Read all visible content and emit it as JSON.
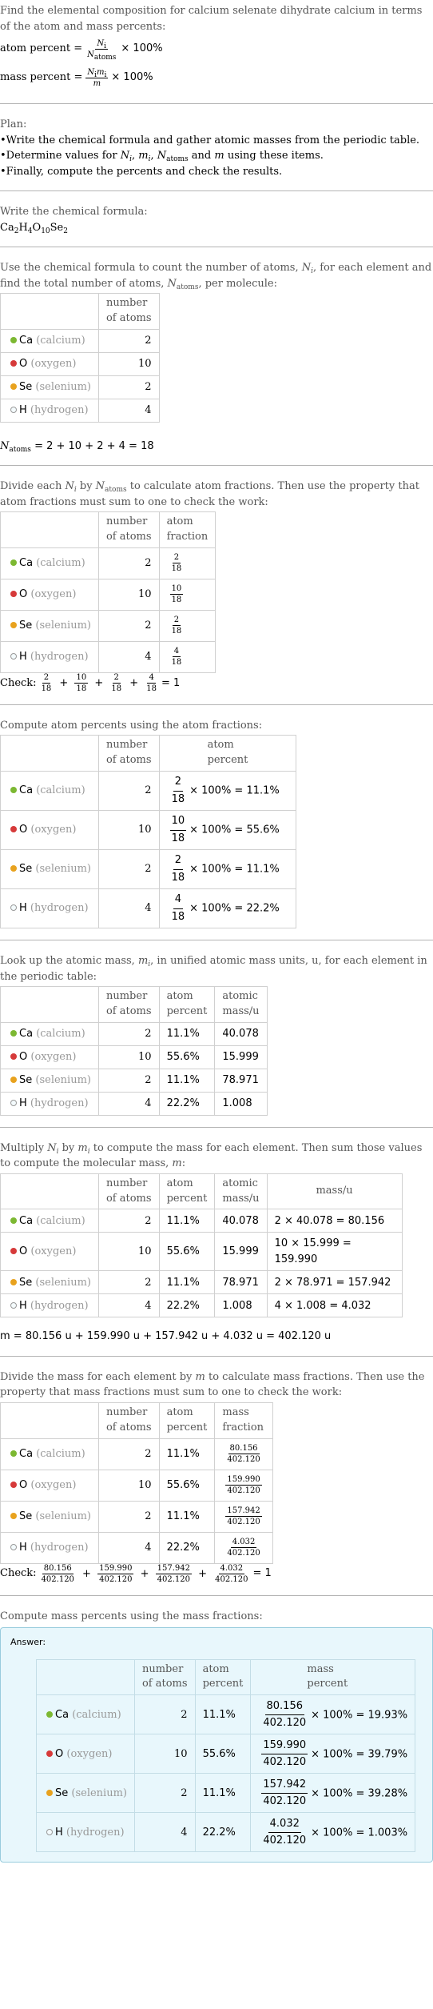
{
  "intro": {
    "question": "Find the elemental composition for calcium selenate dihydrate calcium in terms of the atom and mass percents:",
    "atom_percent_label": "atom percent =",
    "mass_percent_label": "mass percent =",
    "times_100": "× 100%",
    "atom_frac_num": "N",
    "atom_frac_num_sub": "i",
    "atom_frac_den": "N",
    "atom_frac_den_sub": "atoms",
    "mass_frac_num": "N",
    "mass_frac_num_sub": "i",
    "mass_frac_num2": "m",
    "mass_frac_num2_sub": "i",
    "mass_frac_den": "m"
  },
  "plan": {
    "title": "Plan:",
    "items": [
      "Write the chemical formula and gather atomic masses from the periodic table.",
      "Determine values for N_i, m_i, N_atoms and m using these items.",
      "Finally, compute the percents and check the results."
    ],
    "item2_prefix": "Determine values for ",
    "item2_suffix": " using these items."
  },
  "formula": {
    "title": "Write the chemical formula:",
    "parts": [
      {
        "sym": "Ca",
        "sub": "2"
      },
      {
        "sym": "H",
        "sub": "4"
      },
      {
        "sym": "O",
        "sub": "10"
      },
      {
        "sym": "Se",
        "sub": "2"
      }
    ]
  },
  "elements": [
    {
      "symbol": "Ca",
      "name": "(calcium)",
      "color": "#7cb832",
      "hollow": false,
      "atoms": "2",
      "atom_fraction_num": "2",
      "atom_fraction_den": "18",
      "atom_percent": "11.1%",
      "atomic_mass": "40.078",
      "mass_calc": "2 × 40.078 = 80.156",
      "mass": "80.156",
      "mass_percent": "19.93%"
    },
    {
      "symbol": "O",
      "name": "(oxygen)",
      "color": "#d63a3a",
      "hollow": false,
      "atoms": "10",
      "atom_fraction_num": "10",
      "atom_fraction_den": "18",
      "atom_percent": "55.6%",
      "atomic_mass": "15.999",
      "mass_calc": "10 × 15.999 = 159.990",
      "mass": "159.990",
      "mass_percent": "39.79%"
    },
    {
      "symbol": "Se",
      "name": "(selenium)",
      "color": "#e8a21e",
      "hollow": false,
      "atoms": "2",
      "atom_fraction_num": "2",
      "atom_fraction_den": "18",
      "atom_percent": "11.1%",
      "atomic_mass": "78.971",
      "mass_calc": "2 × 78.971 = 157.942",
      "mass": "157.942",
      "mass_percent": "39.28%"
    },
    {
      "symbol": "H",
      "name": "(hydrogen)",
      "color": "#f4fbfd",
      "hollow": true,
      "atoms": "4",
      "atom_fraction_num": "4",
      "atom_fraction_den": "18",
      "atom_percent": "22.2%",
      "atomic_mass": "1.008",
      "mass_calc": "4 × 1.008 = 4.032",
      "mass": "4.032",
      "mass_percent": "1.003%"
    }
  ],
  "headers": {
    "number_of_atoms": [
      "number",
      "of atoms"
    ],
    "atom_fraction": [
      "atom",
      "fraction"
    ],
    "atom_percent": [
      "atom",
      "percent"
    ],
    "atomic_mass": [
      "atomic",
      "mass/u"
    ],
    "mass": "mass/u",
    "mass_fraction": [
      "mass",
      "fraction"
    ],
    "mass_percent": [
      "mass",
      "percent"
    ]
  },
  "step_count": {
    "text_a": "Use the chemical formula to count the number of atoms, ",
    "text_b": ", for each element and find the total number of atoms, ",
    "text_c": ", per molecule:",
    "total_prefix": "N",
    "total_sub": "atoms",
    "total_expr": " = 2 + 10 + 2 + 4 = 18"
  },
  "step_fraction": {
    "text_a": "Divide each ",
    "text_b": " by ",
    "text_c": " to calculate atom fractions. Then use the property that atom fractions must sum to one to check the work:",
    "check_label": "Check:",
    "check_result": "= 1"
  },
  "step_atom_percent": {
    "text": "Compute atom percents using the atom fractions:",
    "den": "18"
  },
  "step_lookup": {
    "text_a": "Look up the atomic mass, ",
    "text_b": ", in unified atomic mass units, u, for each element in the periodic table:"
  },
  "step_mass": {
    "text_a": "Multiply ",
    "text_b": " by ",
    "text_c": " to compute the mass for each element. Then sum those values to compute the molecular mass, ",
    "text_d": ":",
    "total_expr": "m = 80.156 u + 159.990 u + 157.942 u + 4.032 u = 402.120 u",
    "molecular_mass": "402.120"
  },
  "step_mass_fraction": {
    "text_a": "Divide the mass for each element by ",
    "text_b": " to calculate mass fractions. Then use the property that mass fractions must sum to one to check the work:",
    "check_label": "Check:",
    "check_result": "= 1"
  },
  "step_mass_percent": {
    "text": "Compute mass percents using the mass fractions:",
    "answer_label": "Answer:"
  }
}
